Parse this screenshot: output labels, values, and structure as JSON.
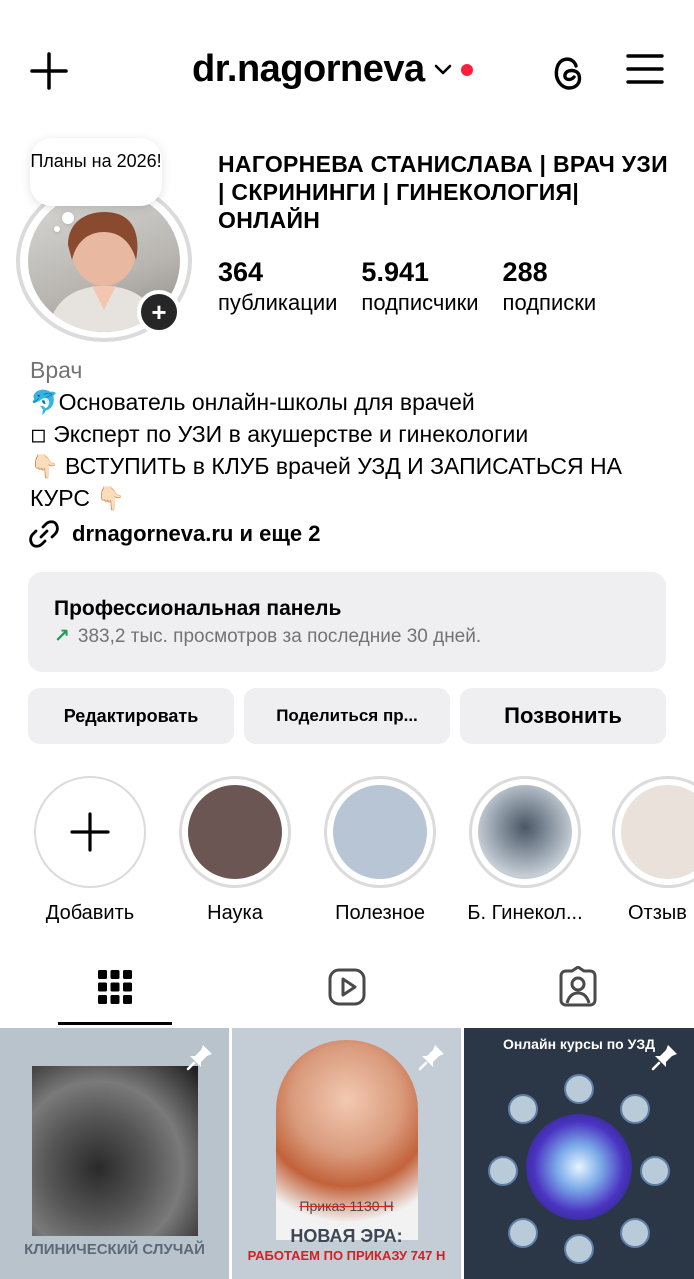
{
  "header": {
    "username": "dr.nagorneva"
  },
  "profile": {
    "note": "Планы на 2026!",
    "full_name": "НАГОРНЕВА СТАНИСЛАВА | ВРАЧ УЗИ | СКРИНИНГИ | ГИНЕКОЛОГИЯ| ОНЛАЙН",
    "stats": [
      {
        "value": "364",
        "label": "публикации"
      },
      {
        "value": "5.941",
        "label": "подписчики"
      },
      {
        "value": "288",
        "label": "подписки"
      }
    ],
    "category": "Врач",
    "bio_lines": [
      "🐬Основатель онлайн-школы для врачей",
      "◽ Эксперт по УЗИ в акушерстве и гинекологии",
      "👇🏻 ВСТУПИТЬ в КЛУБ врачей УЗД И ЗАПИСАТЬСЯ НА КУРС 👇🏻"
    ],
    "link": "drnagorneva.ru и еще 2"
  },
  "pro_panel": {
    "title": "Профессиональная панель",
    "subtitle": "383,2 тыс. просмотров за последние 30 дней."
  },
  "buttons": {
    "edit": "Редактировать",
    "share": "Поделиться пр...",
    "call": "Позвонить"
  },
  "highlights": [
    {
      "label": "Добавить",
      "color": "#ffffff"
    },
    {
      "label": "Наука",
      "color": "#6b5653"
    },
    {
      "label": "Полезное",
      "color": "#b8c5d4"
    },
    {
      "label": "Б. Гинекол...",
      "color": "#9aa6b2"
    },
    {
      "label": "Отзыв",
      "color": "#e9e1da"
    }
  ],
  "posts": [
    {
      "caption": "КЛИНИЧЕСКИЙ СЛУЧАЙ"
    },
    {
      "strike": "Приказ 1130 Н",
      "title": "НОВАЯ ЭРА:",
      "subtitle": "РАБОТАЕМ ПО ПРИКАЗУ 747 Н"
    },
    {
      "title": "Онлайн курсы по УЗД"
    }
  ],
  "colors": {
    "accent_dot": "#ff1f3d",
    "panel_bg": "#efeff1",
    "trend_green": "#1f9d55"
  }
}
